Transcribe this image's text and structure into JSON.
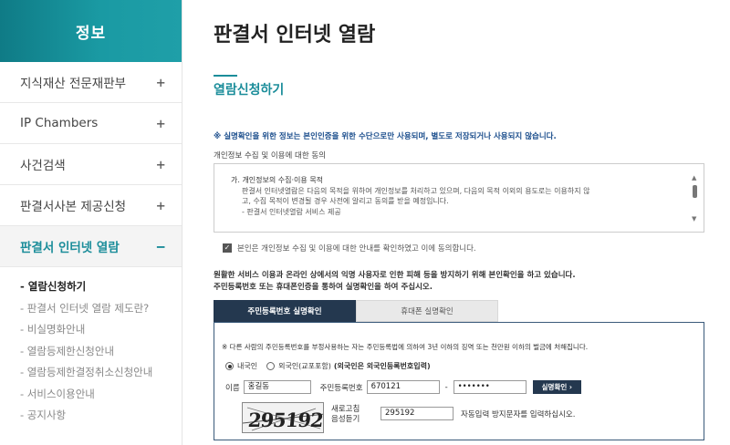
{
  "sidebar": {
    "title": "정보",
    "items": [
      {
        "label": "지식재산 전문재판부",
        "toggle": "+"
      },
      {
        "label": "IP Chambers",
        "toggle": "+"
      },
      {
        "label": "사건검색",
        "toggle": "+"
      },
      {
        "label": "판결서사본 제공신청",
        "toggle": "+"
      },
      {
        "label": "판결서 인터넷 열람",
        "toggle": "−"
      }
    ],
    "submenu": [
      "- 열람신청하기",
      "- 판결서 인터넷 열람 제도란?",
      "- 비실명화안내",
      "- 열람등제한신청안내",
      "- 열람등제한결정취소신청안내",
      "- 서비스이용안내",
      "- 공지사항"
    ]
  },
  "main": {
    "page_title": "판결서 인터넷 열람",
    "section_title": "열람신청하기",
    "notice": "※ 실명확인을 위한 정보는 본인인증을 위한 수단으로만 사용되며, 별도로 저장되거나 사용되지 않습니다.",
    "consent_title": "개인정보 수집 및 이용에 대한 동의",
    "consent_lines": [
      "가. 개인정보의 수집·이용 목적",
      "판결서 인터넷열람은 다음의 목적을 위하여 개인정보를 처리하고 있으며, 다음의 목적 이외의 용도로는 이용하지 않",
      "고, 수집 목적이 변경될 경우 사전에 알리고 동의를 받을 예정입니다.",
      "- 판결서 인터넷열람 서비스 제공"
    ],
    "agree_label": "본인은 개인정보 수집 및 이용에 대한 안내를 확인하였고 이에 동의합니다.",
    "desc_lines": [
      "원활한 서비스 이용과 온라인 상에서의 익명 사용자로 인한 피해 등을 방지하기 위해 본인확인을 하고 있습니다.",
      "주민등록번호 또는 휴대폰인증을 통하여 실명확인을 하여 주십시오."
    ],
    "tabs": [
      "주민등록번호 실명확인",
      "휴대폰 실명확인"
    ],
    "warning": "※ 다른 사람의 주민등록번호를 부정사용하는 자는 주민등록법에 의하여 3년 이하의 징역 또는 천만원 이하의 벌금에 처해집니다.",
    "radio_domestic": "내국인",
    "radio_foreign": "외국인(교포포함)",
    "radio_foreign_note": "(외국인은 외국인등록번호입력)",
    "name_label": "이름",
    "name_value": "홍길동",
    "rrn_label": "주민등록번호",
    "rrn_front": "670121",
    "rrn_dash": "-",
    "rrn_back": "•••••••",
    "verify_button": "실명확인 ›",
    "captcha_text": "295192",
    "refresh_label_1": "새로고침",
    "refresh_label_2": "음성듣기",
    "captcha_input": "295192",
    "captcha_hint": "자동입력 방지문자를 입력하십시오."
  }
}
